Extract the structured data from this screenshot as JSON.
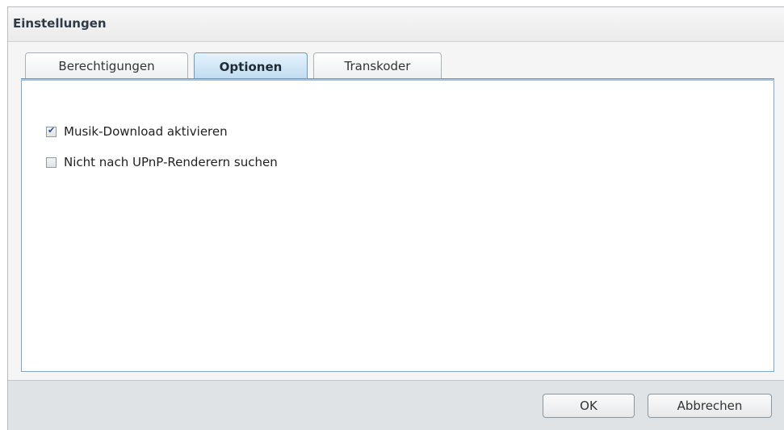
{
  "dialog": {
    "title": "Einstellungen",
    "tabs": [
      {
        "label": "Berechtigungen",
        "active": false
      },
      {
        "label": "Optionen",
        "active": true
      },
      {
        "label": "Transkoder",
        "active": false
      }
    ],
    "options": [
      {
        "label": "Musik-Download aktivieren",
        "checked": true
      },
      {
        "label": "Nicht nach UPnP-Renderern suchen",
        "checked": false
      }
    ],
    "buttons": {
      "ok": "OK",
      "cancel": "Abbrechen"
    }
  },
  "colors": {
    "active_tab": "#bfdbf0",
    "panel_border": "#7ea8cc",
    "footer": "#e0e3e6"
  },
  "icons": {
    "checkbox_checked": "checkmark-icon"
  }
}
